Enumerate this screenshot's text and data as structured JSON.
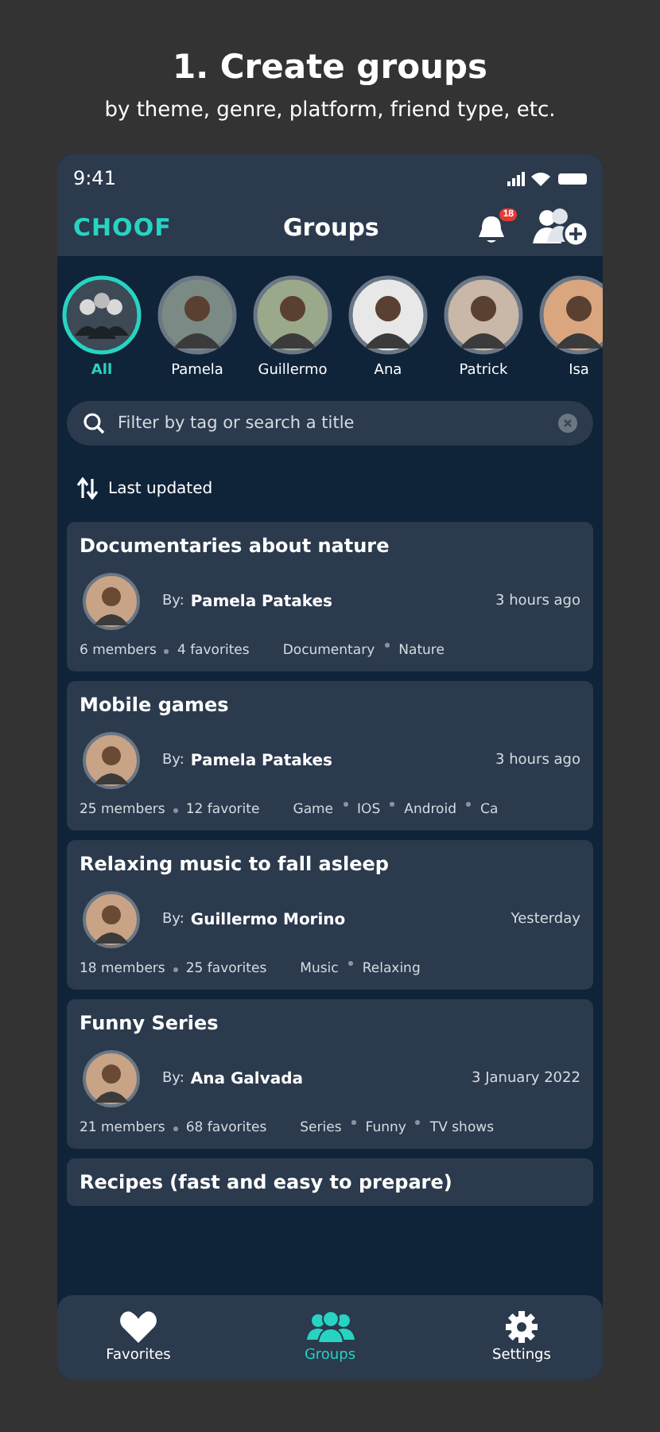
{
  "heading": {
    "title": "1. Create groups",
    "subtitle": "by theme, genre, platform, friend type, etc."
  },
  "status_bar": {
    "time": "9:41"
  },
  "app_bar": {
    "logo": "CHOOF",
    "title": "Groups",
    "notification_count": "18"
  },
  "friends": [
    {
      "name": "All",
      "selected": true,
      "kind": "group"
    },
    {
      "name": "Pamela",
      "selected": false,
      "kind": "person"
    },
    {
      "name": "Guillermo",
      "selected": false,
      "kind": "person"
    },
    {
      "name": "Ana",
      "selected": false,
      "kind": "person"
    },
    {
      "name": "Patrick",
      "selected": false,
      "kind": "person"
    },
    {
      "name": "Isa",
      "selected": false,
      "kind": "person"
    }
  ],
  "search": {
    "placeholder": "Filter by tag or search a title"
  },
  "sort": {
    "label": "Last updated"
  },
  "groups": [
    {
      "title": "Documentaries about nature",
      "by": "By:",
      "author": "Pamela Patakes",
      "time": "3 hours ago",
      "members": "6 members",
      "favorites": "4 favorites",
      "tags": [
        "Documentary",
        "Nature"
      ]
    },
    {
      "title": "Mobile games",
      "by": "By:",
      "author": "Pamela Patakes",
      "time": "3 hours ago",
      "members": "25 members",
      "favorites": "12 favorite",
      "tags": [
        "Game",
        "IOS",
        "Android",
        "Ca"
      ]
    },
    {
      "title": "Relaxing music to fall asleep",
      "by": "By:",
      "author": "Guillermo Morino",
      "time": "Yesterday",
      "members": "18 members",
      "favorites": "25 favorites",
      "tags": [
        "Music",
        "Relaxing"
      ]
    },
    {
      "title": "Funny Series",
      "by": "By:",
      "author": "Ana Galvada",
      "time": "3 January 2022",
      "members": "21 members",
      "favorites": "68 favorites",
      "tags": [
        "Series",
        "Funny",
        "TV shows"
      ]
    },
    {
      "title": "Recipes (fast and easy to prepare)"
    }
  ],
  "nav": [
    {
      "label": "Favorites",
      "kind": "heart",
      "selected": false
    },
    {
      "label": "Groups",
      "kind": "groups",
      "selected": true
    },
    {
      "label": "Settings",
      "kind": "gear",
      "selected": false
    }
  ]
}
